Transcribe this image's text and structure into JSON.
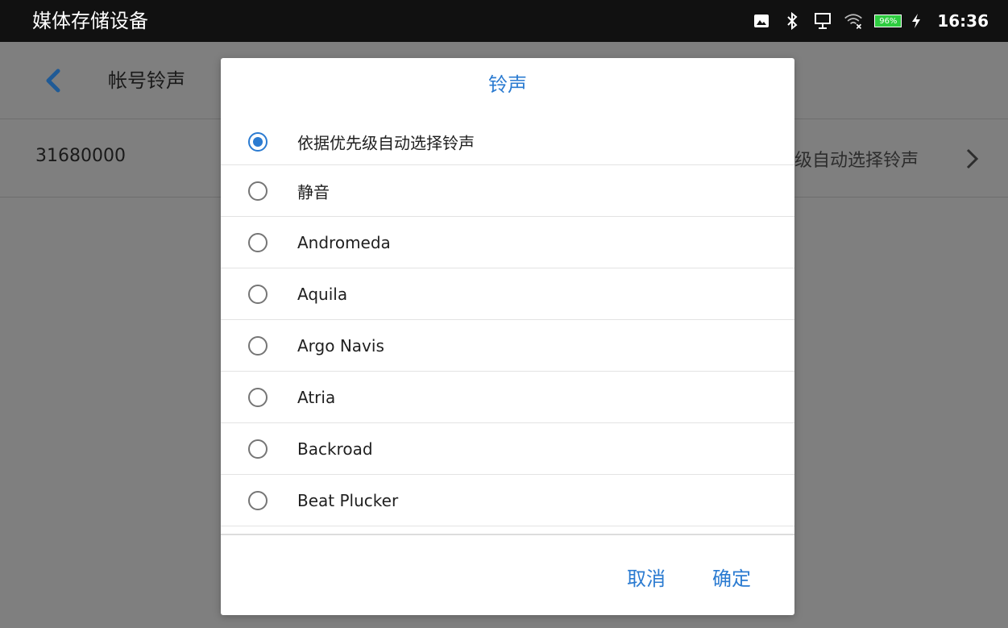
{
  "status_bar": {
    "title": "媒体存储设备",
    "battery_percent": "96%",
    "time": "16:36",
    "icons": [
      "image-icon",
      "bluetooth-icon",
      "network-icon",
      "wifi-off-icon",
      "battery-icon",
      "charging-icon"
    ]
  },
  "page": {
    "title": "帐号铃声",
    "row": {
      "account": "31680000",
      "value": "级自动选择铃声"
    }
  },
  "dialog": {
    "title": "铃声",
    "options": [
      {
        "label": "依据优先级自动选择铃声",
        "selected": true
      },
      {
        "label": "静音",
        "selected": false
      },
      {
        "label": "Andromeda",
        "selected": false
      },
      {
        "label": "Aquila",
        "selected": false
      },
      {
        "label": "Argo Navis",
        "selected": false
      },
      {
        "label": "Atria",
        "selected": false
      },
      {
        "label": "Backroad",
        "selected": false
      },
      {
        "label": "Beat Plucker",
        "selected": false
      }
    ],
    "cancel_label": "取消",
    "ok_label": "确定"
  },
  "colors": {
    "accent": "#2b7bd1",
    "status_bar_bg": "#111111",
    "scrim": "#7f7f7f",
    "battery": "#2ecc40"
  }
}
